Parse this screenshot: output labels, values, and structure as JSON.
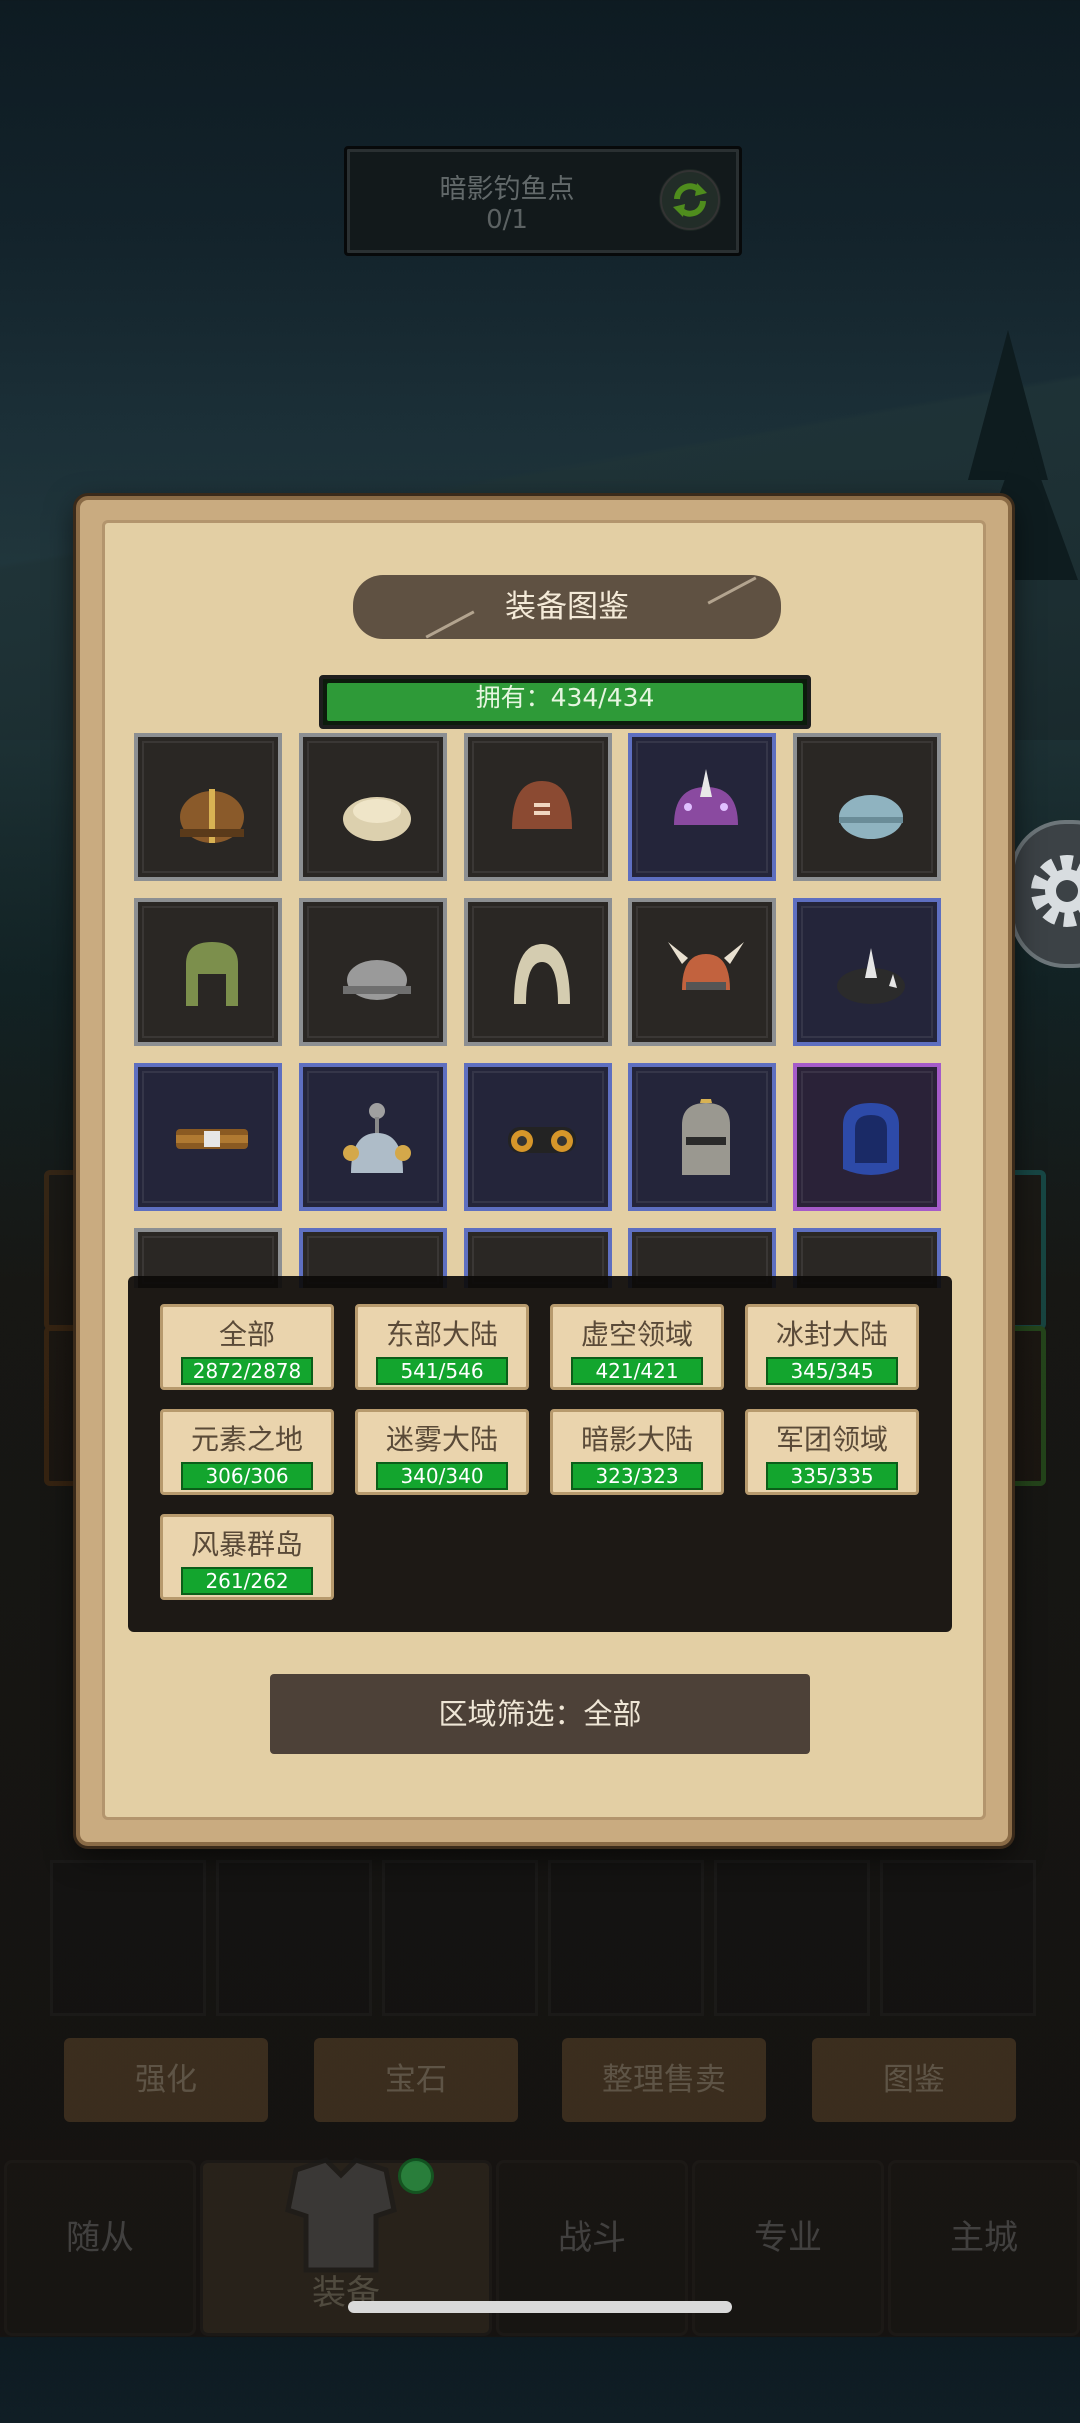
{
  "fishing_spot": {
    "name": "暗影钓鱼点",
    "count": "0/1",
    "icon": "refresh-icon"
  },
  "catalog": {
    "title": "装备图鉴",
    "owned_label": "拥有：434/434",
    "owned_fraction": 1.0,
    "items": [
      {
        "name": "leather-cap-icon",
        "rarity": "common"
      },
      {
        "name": "cloth-cap-icon",
        "rarity": "common"
      },
      {
        "name": "brown-helm-icon",
        "rarity": "common"
      },
      {
        "name": "spiked-purple-helm-icon",
        "rarity": "rare"
      },
      {
        "name": "teal-cap-icon",
        "rarity": "common"
      },
      {
        "name": "green-hood-icon",
        "rarity": "common"
      },
      {
        "name": "iron-cap-icon",
        "rarity": "common"
      },
      {
        "name": "white-hood-icon",
        "rarity": "common"
      },
      {
        "name": "horned-helm-icon",
        "rarity": "common"
      },
      {
        "name": "black-spiked-cap-icon",
        "rarity": "rare"
      },
      {
        "name": "circlet-icon",
        "rarity": "rare"
      },
      {
        "name": "antenna-helm-icon",
        "rarity": "rare"
      },
      {
        "name": "goggles-icon",
        "rarity": "rare"
      },
      {
        "name": "knight-helm-icon",
        "rarity": "rare"
      },
      {
        "name": "blue-hood-icon",
        "rarity": "epic"
      }
    ]
  },
  "regions": [
    {
      "name": "全部",
      "count": "2872/2878"
    },
    {
      "name": "东部大陆",
      "count": "541/546"
    },
    {
      "name": "虚空领域",
      "count": "421/421"
    },
    {
      "name": "冰封大陆",
      "count": "345/345"
    },
    {
      "name": "元素之地",
      "count": "306/306"
    },
    {
      "name": "迷雾大陆",
      "count": "340/340"
    },
    {
      "name": "暗影大陆",
      "count": "323/323"
    },
    {
      "name": "军团领域",
      "count": "335/335"
    },
    {
      "name": "风暴群岛",
      "count": "261/262"
    }
  ],
  "filter_label": "区域筛选：全部",
  "function_buttons": [
    "强化",
    "宝石",
    "整理售卖",
    "图鉴"
  ],
  "nav": [
    "随从",
    "装备",
    "战斗",
    "专业",
    "主城"
  ],
  "colors": {
    "parchment": "#e3cfa4",
    "progress": "#2e9a38",
    "rare_border": "#5e6fc0",
    "epic_border": "#a55bc9"
  }
}
